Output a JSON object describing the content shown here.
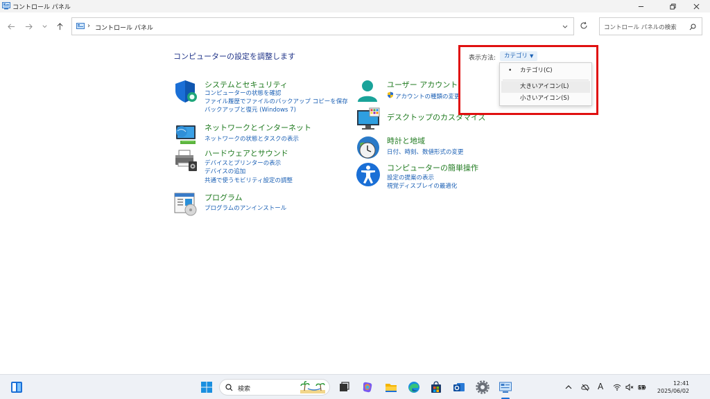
{
  "window": {
    "title": "コントロール パネル"
  },
  "address": {
    "separator": "›",
    "path": "コントロール パネル",
    "search_placeholder": "コントロール パネルの検索"
  },
  "main": {
    "heading": "コンピューターの設定を調整します",
    "view_by_label": "表示方法:",
    "view_by_value": "カテゴリ",
    "categories_left": [
      {
        "title": "システムとセキュリティ",
        "links": [
          "コンピューターの状態を確認",
          "ファイル履歴でファイルのバックアップ コピーを保存",
          "バックアップと復元 (Windows 7)"
        ]
      },
      {
        "title": "ネットワークとインターネット",
        "links": [
          "ネットワークの状態とタスクの表示"
        ]
      },
      {
        "title": "ハードウェアとサウンド",
        "links": [
          "デバイスとプリンターの表示",
          "デバイスの追加",
          "共通で使うモビリティ設定の調整"
        ]
      },
      {
        "title": "プログラム",
        "links": [
          "プログラムのアンインストール"
        ]
      }
    ],
    "categories_right": [
      {
        "title": "ユーザー アカウント",
        "links": [
          "アカウントの種類の変更"
        ]
      },
      {
        "title": "デスクトップのカスタマイズ",
        "links": []
      },
      {
        "title": "時計と地域",
        "links": [
          "日付、時刻、数値形式の変更"
        ]
      },
      {
        "title": "コンピューターの簡単操作",
        "links": [
          "設定の提案の表示",
          "視覚ディスプレイの最適化"
        ]
      }
    ]
  },
  "menu": {
    "bullet": "•",
    "items": [
      "カテゴリ(C)",
      "大きいアイコン(L)",
      "小さいアイコン(S)"
    ]
  },
  "taskbar": {
    "search_placeholder": "検索",
    "time": "12:41",
    "date": "2025/06/02",
    "ime": "A"
  },
  "colors": {
    "category_title": "#1f7a1f",
    "link": "#1a5fb4",
    "heading": "#1e3287",
    "highlight_box": "#e01010"
  }
}
